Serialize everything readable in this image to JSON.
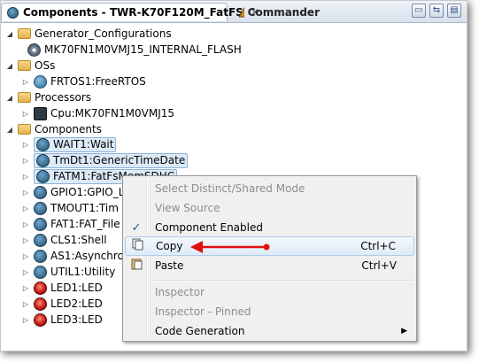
{
  "tabs": {
    "active_label": "Components - TWR-K70F120M_FatFS",
    "active_close": "✕",
    "inactive_label": "Commander"
  },
  "toolbar_icons": [
    "collapse-icon",
    "link-icon",
    "folder-icon"
  ],
  "tree": {
    "generator_configurations": "Generator_Configurations",
    "flash_config": "MK70FN1M0VMJ15_INTERNAL_FLASH",
    "oss": "OSs",
    "freertos": "FRTOS1:FreeRTOS",
    "processors": "Processors",
    "cpu": "Cpu:MK70FN1M0VMJ15",
    "components": "Components",
    "items": [
      "WAIT1:Wait",
      "TmDt1:GenericTimeDate",
      "FATM1:FatFsMemSDHC",
      "GPIO1:GPIO_L",
      "TMOUT1:Tim",
      "FAT1:FAT_File",
      "CLS1:Shell",
      "AS1:Asynchro",
      "UTIL1:Utility",
      "LED1:LED",
      "LED2:LED",
      "LED3:LED"
    ]
  },
  "context_menu": {
    "select_distinct": "Select Distinct/Shared Mode",
    "view_source": "View Source",
    "component_enabled": "Component Enabled",
    "copy": "Copy",
    "copy_shortcut": "Ctrl+C",
    "paste": "Paste",
    "paste_shortcut": "Ctrl+V",
    "inspector": "Inspector",
    "inspector_pinned": "Inspector - Pinned",
    "code_generation": "Code Generation"
  },
  "colors": {
    "annotation_arrow": "#e01010",
    "selection_bg": "#dceaf8"
  }
}
